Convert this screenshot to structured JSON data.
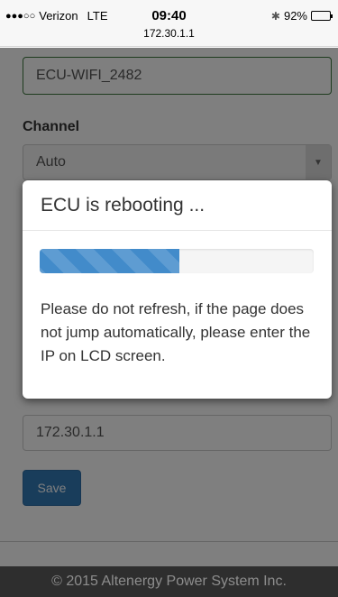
{
  "status_bar": {
    "signal_dots": "●●●○○",
    "carrier": "Verizon",
    "network": "LTE",
    "time": "09:40",
    "url": "172.30.1.1",
    "bluetooth_glyph": "✱",
    "battery_percent": "92%",
    "battery_level": 0.92
  },
  "form": {
    "ssid_value": "ECU-WIFI_2482",
    "channel_label": "Channel",
    "channel_value": "Auto",
    "ip_value": "172.30.1.1",
    "save_label": "Save"
  },
  "modal": {
    "title": "ECU is rebooting ...",
    "progress_percent": 51,
    "message": "Please do not refresh, if the page does not jump automatically, please enter the IP on LCD screen."
  },
  "footer": {
    "copyright": "© 2015 Altenergy Power System Inc."
  },
  "colors": {
    "primary": "#337ab7",
    "progress": "#428bca",
    "success_border": "#3c763d",
    "footer_bg": "#2e2e2e"
  }
}
